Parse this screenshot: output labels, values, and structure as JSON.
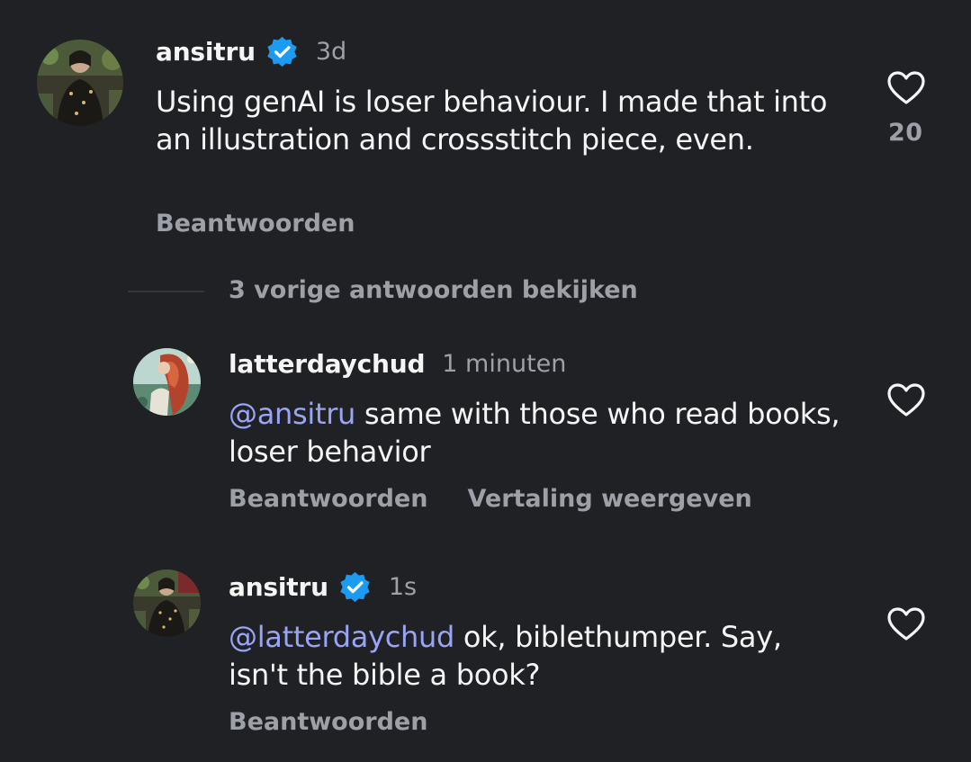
{
  "comments": [
    {
      "username": "ansitru",
      "verified": true,
      "time": "3d",
      "text": "Using genAI is loser behaviour. I made that into an illustration and crossstitch piece, even.",
      "reply_label": "Beantwoorden",
      "likes": "20",
      "like_icon": "heart-outline-icon",
      "avatar_icon": "profile-photo"
    },
    {
      "username": "latterdaychud",
      "verified": false,
      "time": "1 minuten",
      "mention": "@ansitru",
      "text": " same with those who read books, loser behavior",
      "reply_label": "Beantwoorden",
      "translate_label": "Vertaling weergeven",
      "like_icon": "heart-outline-icon",
      "avatar_icon": "profile-photo"
    },
    {
      "username": "ansitru",
      "verified": true,
      "time": "1s",
      "mention": "@latterdaychud",
      "text": " ok, biblethumper. Say, isn't the bible a book?",
      "reply_label": "Beantwoorden",
      "like_icon": "heart-outline-icon",
      "avatar_icon": "profile-photo"
    }
  ],
  "view_previous_replies": "3 vorige antwoorden bekijken",
  "colors": {
    "background": "#202125",
    "text": "#f5f5f5",
    "muted": "#9da0a6",
    "mention": "#9aa4f4",
    "verified": "#1d9bf0"
  }
}
